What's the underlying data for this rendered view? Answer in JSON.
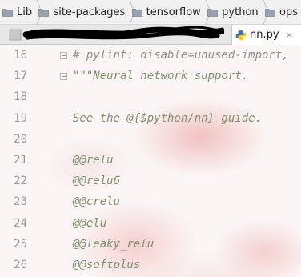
{
  "breadcrumb": {
    "items": [
      {
        "label": "Lib",
        "icon": "folder-icon"
      },
      {
        "label": "site-packages",
        "icon": "folder-icon"
      },
      {
        "label": "tensorflow",
        "icon": "folder-icon"
      },
      {
        "label": "python",
        "icon": "folder-icon"
      },
      {
        "label": "ops",
        "icon": "folder-icon"
      }
    ]
  },
  "tabs": {
    "active_label": "nn.py",
    "active_icon": "python-file-icon",
    "close_glyph": "×"
  },
  "editor": {
    "lines": [
      {
        "num": "16",
        "text": "# pylint: disable=unused-import,",
        "kind": "comment"
      },
      {
        "num": "17",
        "text": "\"\"\"Neural network support.",
        "kind": "docstring"
      },
      {
        "num": "18",
        "text": "",
        "kind": "docstring"
      },
      {
        "num": "19",
        "text": "See the @{$python/nn} guide.",
        "kind": "docstring"
      },
      {
        "num": "20",
        "text": "",
        "kind": "docstring"
      },
      {
        "num": "21",
        "text": "@@relu",
        "kind": "docstring"
      },
      {
        "num": "22",
        "text": "@@relu6",
        "kind": "docstring"
      },
      {
        "num": "23",
        "text": "@@crelu",
        "kind": "docstring"
      },
      {
        "num": "24",
        "text": "@@elu",
        "kind": "docstring"
      },
      {
        "num": "25",
        "text": "@@leaky_relu",
        "kind": "docstring"
      },
      {
        "num": "26",
        "text": "@@softplus",
        "kind": "docstring"
      }
    ]
  },
  "colors": {
    "line_number": "#9a9a9a",
    "comment": "#8f8f8f",
    "docstring": "#7f8f6f"
  }
}
